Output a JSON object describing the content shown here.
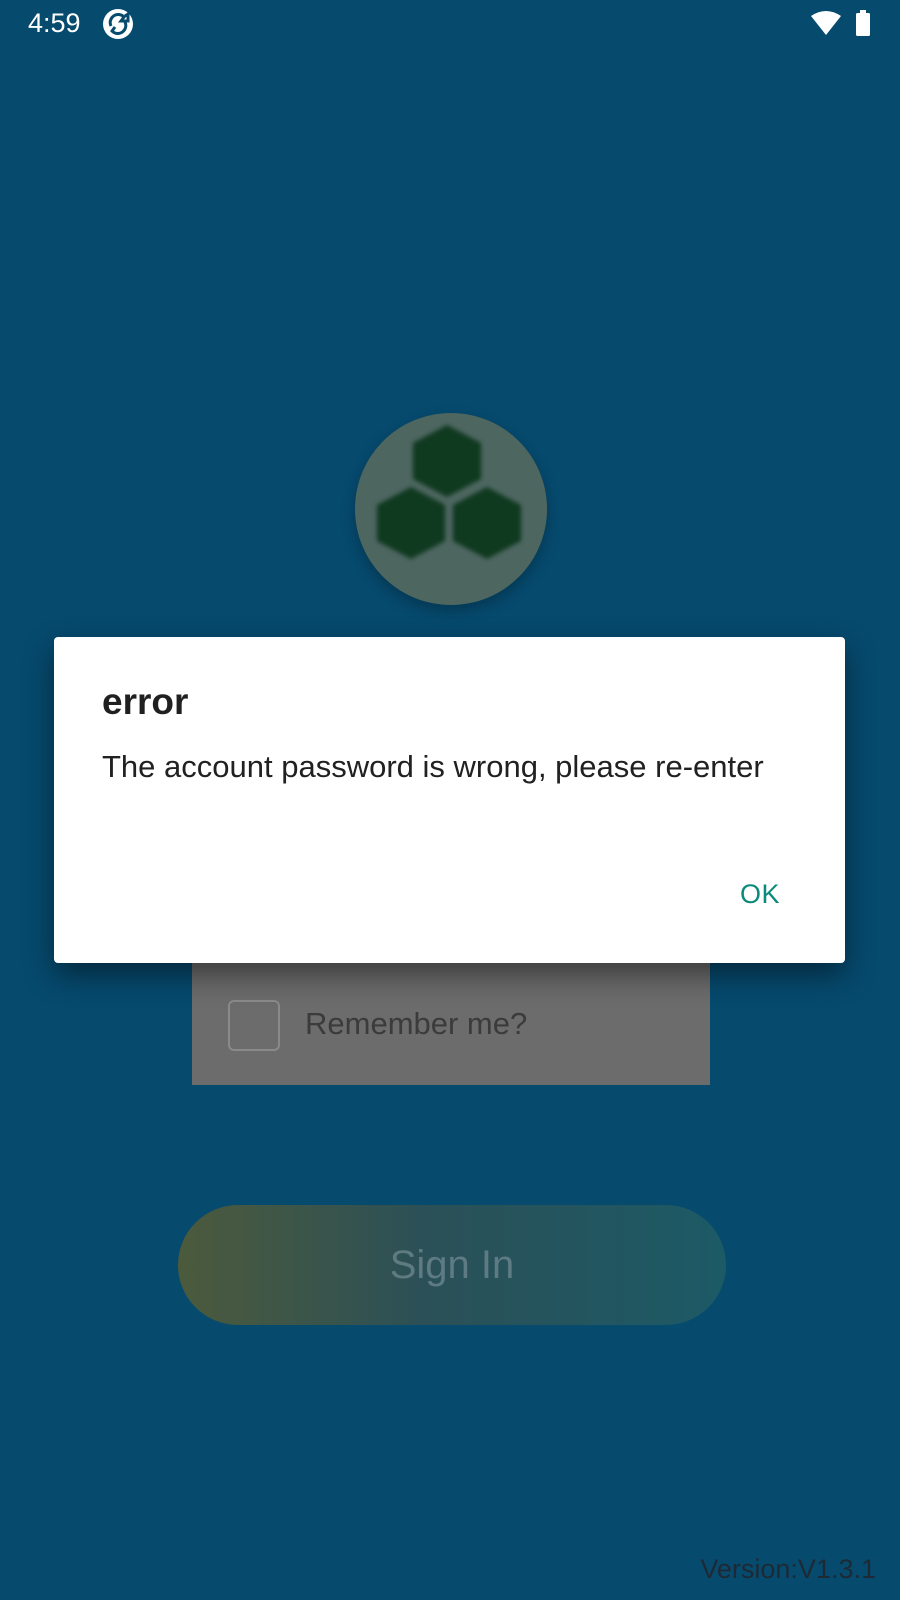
{
  "status_bar": {
    "time": "4:59",
    "icons": [
      "app-sync-icon",
      "wifi-icon",
      "battery-icon"
    ]
  },
  "login": {
    "logo_icon": "hexagon-cluster-logo",
    "remember_label": "Remember me?",
    "remember_checked": false,
    "sign_in_label": "Sign In",
    "version": "Version:V1.3.1"
  },
  "dialog": {
    "title": "error",
    "message": "The account password is wrong, please re-enter",
    "ok_label": "OK"
  },
  "colors": {
    "background": "#064a6e",
    "dialog_button": "#0a8a7c",
    "logo_hex": "#103a20"
  }
}
